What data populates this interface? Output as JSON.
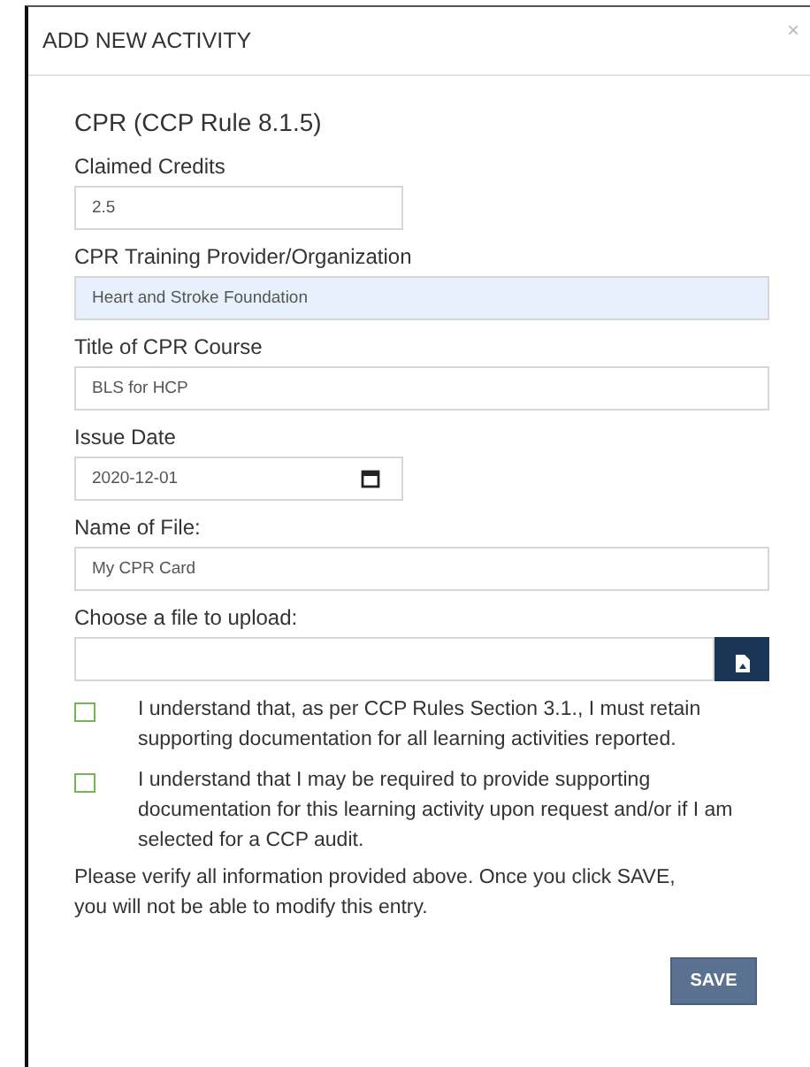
{
  "dialog": {
    "title": "ADD NEW ACTIVITY",
    "close": "×"
  },
  "heading": "CPR (CCP Rule 8.1.5)",
  "fields": [
    {
      "kind": "text",
      "label": "Claimed Credits",
      "value": "2.5",
      "short": true,
      "highlighted": false
    },
    {
      "kind": "text",
      "label": "CPR Training Provider/Organization",
      "value": "Heart and Stroke Foundation",
      "short": false,
      "highlighted": true
    },
    {
      "kind": "text",
      "label": "Title of CPR Course",
      "value": "BLS for HCP",
      "short": false,
      "highlighted": false
    },
    {
      "kind": "date",
      "label": "Issue Date",
      "value": "2020-12-01",
      "short": true,
      "highlighted": false
    },
    {
      "kind": "text",
      "label": "Name of File:",
      "value": "My CPR Card",
      "short": false,
      "highlighted": false
    },
    {
      "kind": "file",
      "label": "Choose a file to upload:",
      "short": false,
      "highlighted": false
    }
  ],
  "agreements": [
    {
      "text": "I understand that, as per CCP Rules Section 3.1., I must retain supporting documentation for all learning activities reported.",
      "checked": false
    },
    {
      "text": "I understand that I may be required to provide supporting documentation for this learning activity upon request and/or if I am selected for a CCP audit.",
      "checked": false
    }
  ],
  "notice": "Please verify all information provided above. Once you click SAVE, you will not be able to modify this entry.",
  "save_button": "SAVE"
}
